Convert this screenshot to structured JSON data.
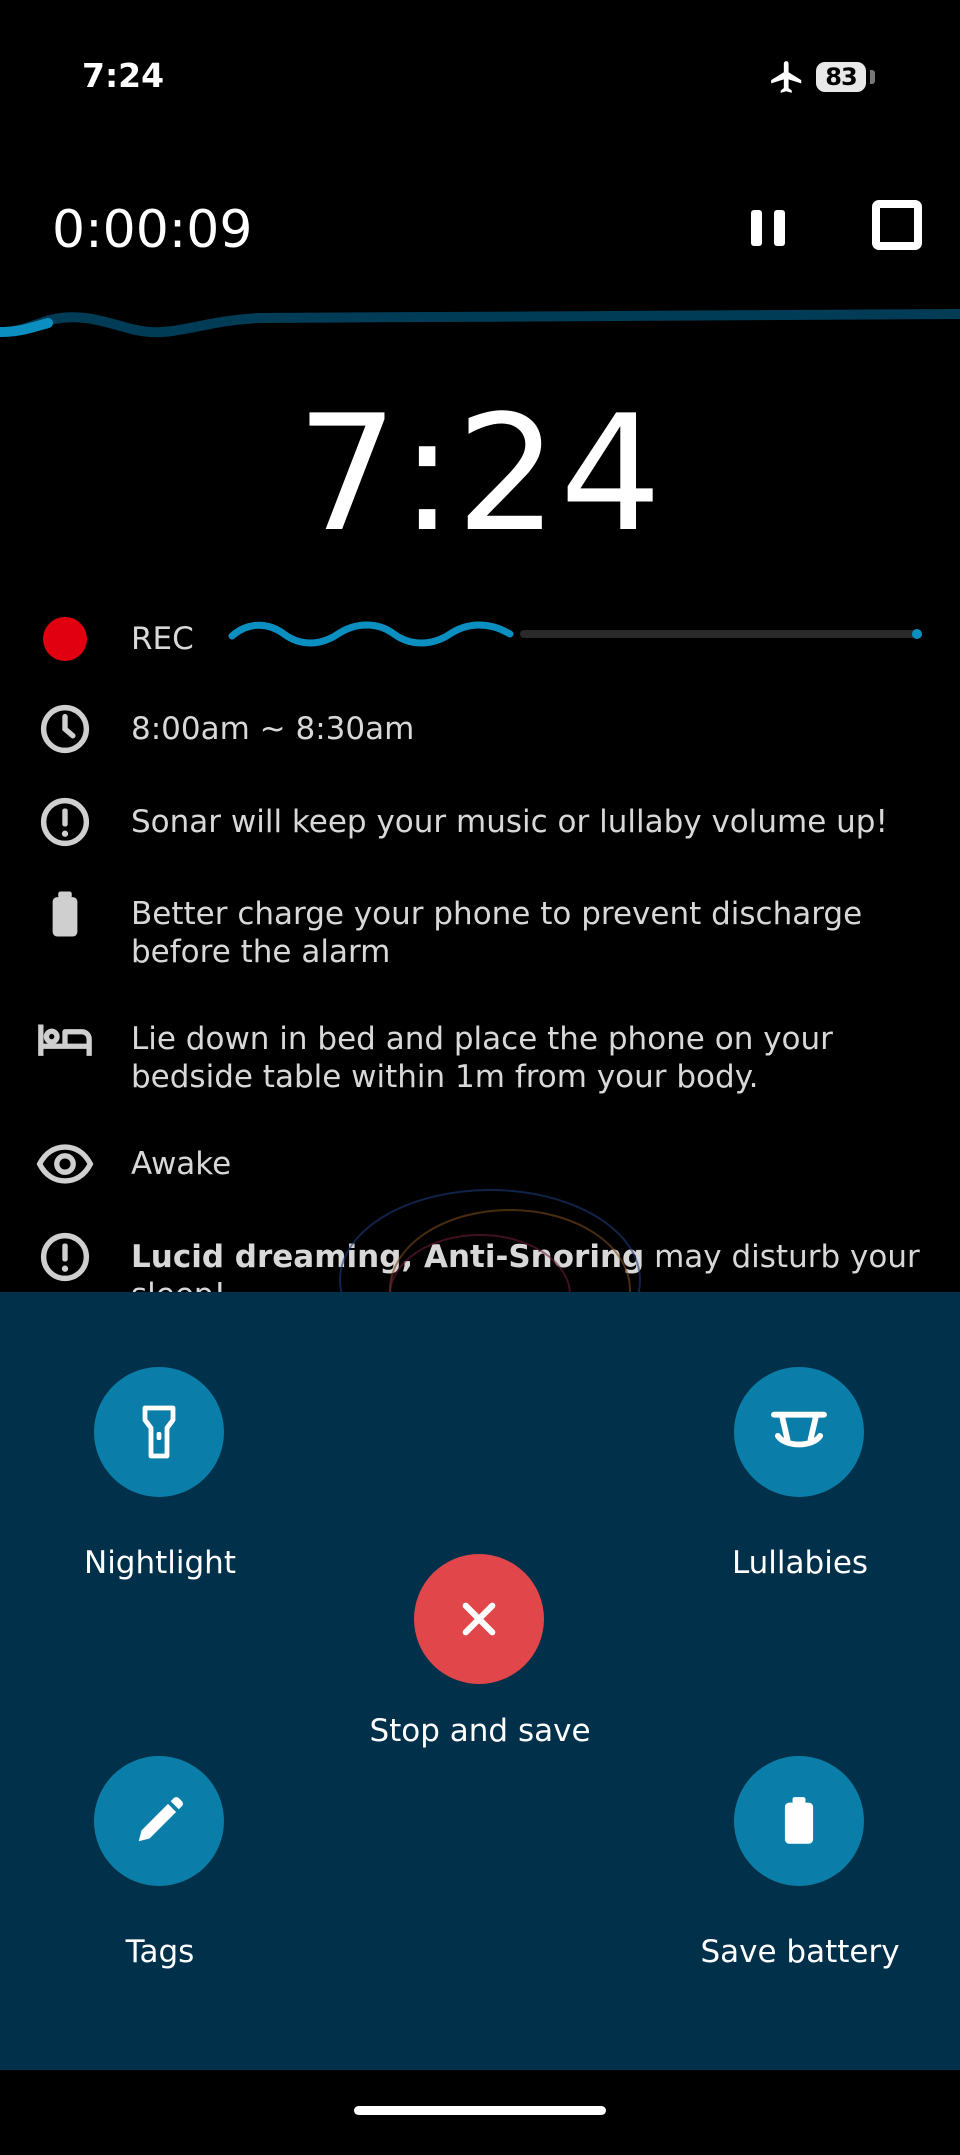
{
  "status_bar": {
    "time": "7:24",
    "battery": "83",
    "airplane_mode": true
  },
  "header": {
    "elapsed": "0:00:09"
  },
  "clock": {
    "time": "7:24"
  },
  "rows": {
    "rec": "REC",
    "alarm_window": "8:00am ~ 8:30am",
    "sonar_tip": "Sonar will keep your music or lullaby volume up!",
    "charge_tip_1": "Better charge your phone to prevent discharge",
    "charge_tip_2": "before the alarm",
    "bed_tip_1": "Lie down in bed and place the phone on your",
    "bed_tip_2": "bedside table within 1m from your body.",
    "state": "Awake",
    "lucid_bold": "Lucid dreaming, Anti-Snoring",
    "lucid_rest": " may disturb your",
    "lucid_line2": "sleep!"
  },
  "actions": {
    "nightlight": "Nightlight",
    "lullabies": "Lullabies",
    "stop_save": "Stop and save",
    "tags": "Tags",
    "save_battery": "Save battery"
  },
  "colors": {
    "accent": "#0a7ea8",
    "panel": "#00304a",
    "stop": "#e0464a",
    "rec": "#e0000f"
  }
}
